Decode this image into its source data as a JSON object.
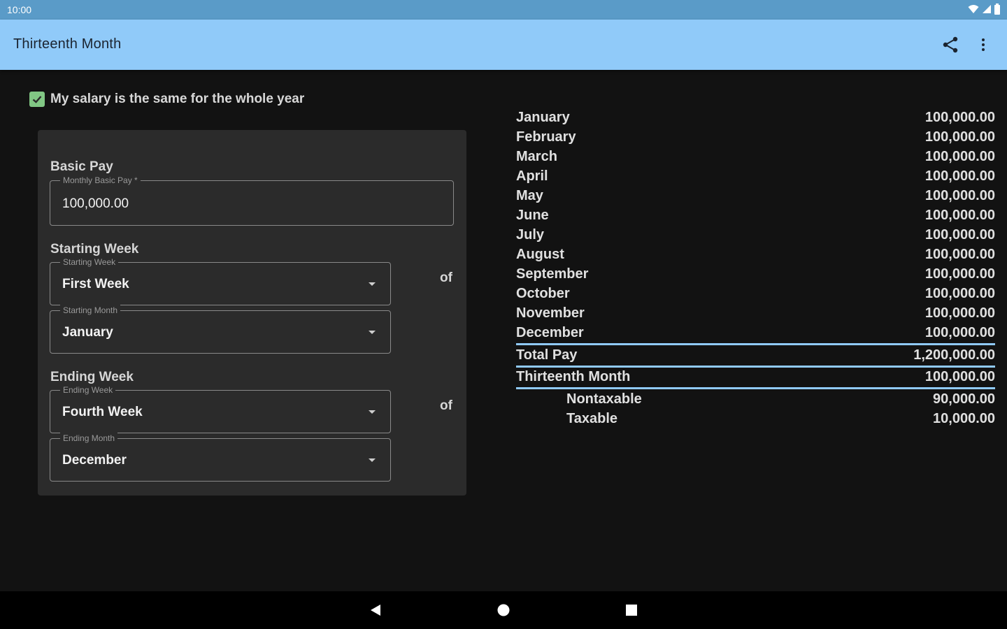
{
  "status_bar": {
    "time": "10:00"
  },
  "app_bar": {
    "title": "Thirteenth Month"
  },
  "checkbox": {
    "label": "My salary is the same for the whole year",
    "checked": true
  },
  "basic_pay": {
    "title": "Basic Pay",
    "field_label": "Monthly Basic Pay *",
    "value": "100,000.00"
  },
  "starting_week": {
    "title": "Starting Week",
    "week_label": "Starting Week",
    "week_value": "First Week",
    "month_label": "Starting Month",
    "month_value": "January",
    "of": "of"
  },
  "ending_week": {
    "title": "Ending Week",
    "week_label": "Ending Week",
    "week_value": "Fourth Week",
    "month_label": "Ending Month",
    "month_value": "December",
    "of": "of"
  },
  "months": [
    {
      "label": "January",
      "value": "100,000.00"
    },
    {
      "label": "February",
      "value": "100,000.00"
    },
    {
      "label": "March",
      "value": "100,000.00"
    },
    {
      "label": "April",
      "value": "100,000.00"
    },
    {
      "label": "May",
      "value": "100,000.00"
    },
    {
      "label": "June",
      "value": "100,000.00"
    },
    {
      "label": "July",
      "value": "100,000.00"
    },
    {
      "label": "August",
      "value": "100,000.00"
    },
    {
      "label": "September",
      "value": "100,000.00"
    },
    {
      "label": "October",
      "value": "100,000.00"
    },
    {
      "label": "November",
      "value": "100,000.00"
    },
    {
      "label": "December",
      "value": "100,000.00"
    }
  ],
  "totals": {
    "total_pay_label": "Total Pay",
    "total_pay_value": "1,200,000.00",
    "thirteenth_label": "Thirteenth Month",
    "thirteenth_value": "100,000.00",
    "nontaxable_label": "Nontaxable",
    "nontaxable_value": "90,000.00",
    "taxable_label": "Taxable",
    "taxable_value": "10,000.00"
  },
  "colors": {
    "app_bar": "#90caf9",
    "status_bar": "#5a9bc8",
    "background": "#121212",
    "card": "#2b2b2b",
    "accent_check": "#81c784",
    "divider": "#90caf9"
  },
  "icons": {
    "share": "share-icon",
    "more": "more-vert-icon",
    "wifi": "wifi-icon",
    "signal": "signal-icon",
    "battery": "battery-icon",
    "back": "back-icon",
    "home": "home-icon",
    "recent": "recent-apps-icon"
  }
}
